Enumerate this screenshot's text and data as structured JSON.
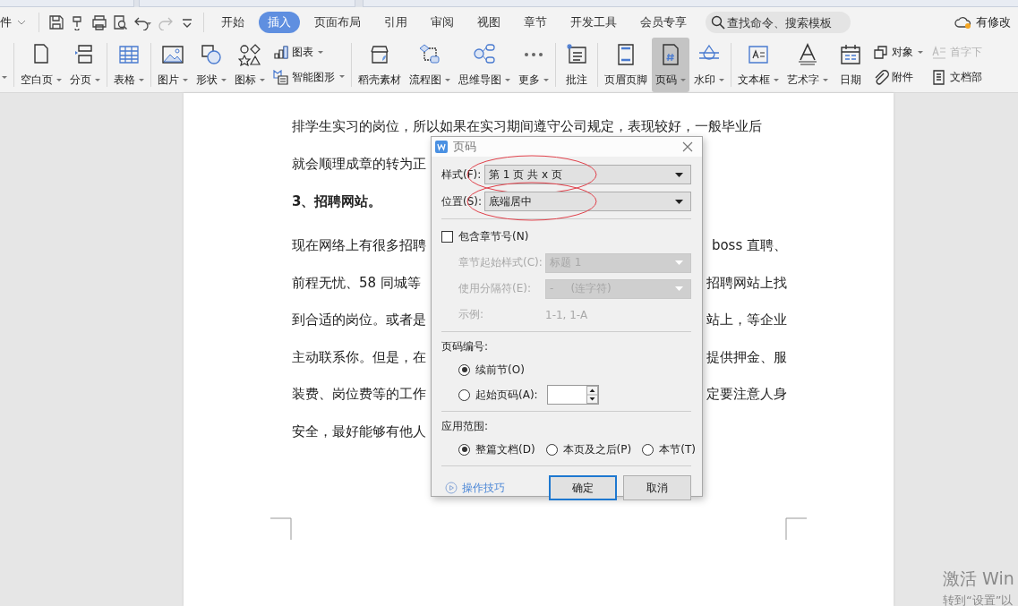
{
  "quick_bar": {
    "file_menu": "件"
  },
  "menu_tabs": [
    {
      "label": "开始",
      "selected": false
    },
    {
      "label": "插入",
      "selected": true
    },
    {
      "label": "页面布局",
      "selected": false
    },
    {
      "label": "引用",
      "selected": false
    },
    {
      "label": "审阅",
      "selected": false
    },
    {
      "label": "视图",
      "selected": false
    },
    {
      "label": "章节",
      "selected": false
    },
    {
      "label": "开发工具",
      "selected": false
    },
    {
      "label": "会员专享",
      "selected": false
    }
  ],
  "search": {
    "placeholder": "查找命令、搜索模板"
  },
  "save_status": {
    "label": "有修改"
  },
  "ribbon": {
    "groups": [
      {
        "items": [
          {
            "kind": "large",
            "label": "空白页",
            "dropdown": true,
            "selected": false,
            "disabled": false
          },
          {
            "kind": "large",
            "label": "分页",
            "dropdown": true,
            "selected": false,
            "disabled": false
          }
        ]
      },
      {
        "items": [
          {
            "kind": "large",
            "label": "表格",
            "dropdown": true,
            "selected": false,
            "disabled": false
          }
        ]
      },
      {
        "items": [
          {
            "kind": "large",
            "label": "图片",
            "dropdown": true,
            "selected": false,
            "disabled": false
          },
          {
            "kind": "large",
            "label": "形状",
            "dropdown": true,
            "selected": false,
            "disabled": false
          },
          {
            "kind": "large",
            "label": "图标",
            "dropdown": true,
            "selected": false,
            "disabled": false
          },
          {
            "kind": "stack",
            "items": [
              {
                "label": "图表",
                "dropdown": true,
                "disabled": false
              },
              {
                "label": "智能图形",
                "dropdown": true,
                "disabled": false
              }
            ]
          }
        ]
      },
      {
        "items": [
          {
            "kind": "large",
            "label": "稻壳素材",
            "dropdown": false,
            "selected": false,
            "disabled": false
          },
          {
            "kind": "large",
            "label": "流程图",
            "dropdown": true,
            "selected": false,
            "disabled": false
          },
          {
            "kind": "large",
            "label": "思维导图",
            "dropdown": true,
            "selected": false,
            "disabled": false
          },
          {
            "kind": "large",
            "label": "更多",
            "dropdown": true,
            "selected": false,
            "disabled": false
          }
        ]
      },
      {
        "items": [
          {
            "kind": "large",
            "label": "批注",
            "dropdown": false,
            "selected": false,
            "disabled": false
          }
        ]
      },
      {
        "items": [
          {
            "kind": "large",
            "label": "页眉页脚",
            "dropdown": false,
            "selected": false,
            "disabled": false
          },
          {
            "kind": "large",
            "label": "页码",
            "dropdown": true,
            "selected": true,
            "disabled": false
          },
          {
            "kind": "large",
            "label": "水印",
            "dropdown": true,
            "selected": false,
            "disabled": false
          }
        ]
      },
      {
        "items": [
          {
            "kind": "large",
            "label": "文本框",
            "dropdown": true,
            "selected": false,
            "disabled": false
          },
          {
            "kind": "large",
            "label": "艺术字",
            "dropdown": true,
            "selected": false,
            "disabled": false
          },
          {
            "kind": "large",
            "label": "日期",
            "dropdown": false,
            "selected": false,
            "disabled": false
          },
          {
            "kind": "stack",
            "items": [
              {
                "label": "对象",
                "dropdown": true,
                "disabled": false
              },
              {
                "label": "附件",
                "dropdown": false,
                "disabled": false
              }
            ]
          },
          {
            "kind": "stack",
            "items": [
              {
                "label": "首字下",
                "dropdown": false,
                "disabled": true
              },
              {
                "label": "文档部",
                "dropdown": false,
                "disabled": false
              }
            ]
          }
        ]
      }
    ]
  },
  "document": {
    "blocks": [
      {
        "kind": "text",
        "lines": [
          {
            "left": "排学生实习的岗位，所以如果在实习期间遵守公司规定，表现较好，一般毕业后"
          },
          {
            "left": "就会顺理成章的转为正"
          }
        ]
      },
      {
        "kind": "heading",
        "text": "3、招聘网站。"
      },
      {
        "kind": "text",
        "lines": [
          {
            "left": "现在网络上有很多招聘",
            "right": "boss 直聘、"
          },
          {
            "left": "前程无忧、58 同城等",
            "right": "招聘网站上找"
          },
          {
            "left": "到合适的岗位。或者是",
            "right": "站上，等企业"
          },
          {
            "left": "主动联系你。但是，在",
            "right": "提供押金、服"
          },
          {
            "left": "装费、岗位费等的工作",
            "right": "定要注意人身"
          },
          {
            "left": "安全，最好能够有他人"
          }
        ]
      }
    ]
  },
  "dialog": {
    "title": "页码",
    "fields": [
      {
        "label": "样式(F):",
        "value": "第 1 页 共 x 页",
        "highlighted": true
      },
      {
        "label": "位置(S):",
        "value": "底端居中",
        "highlighted": true
      }
    ],
    "include_chapter": {
      "label": "包含章节号(N)",
      "checked": false
    },
    "chapter_fields": [
      {
        "label": "章节起始样式(C):",
        "value": "标题 1",
        "disabled": true
      },
      {
        "label": "使用分隔符(E):",
        "value": "-     (连字符)",
        "disabled": true
      }
    ],
    "example": {
      "label": "示例:",
      "value": "1-1, 1-A",
      "disabled": true
    },
    "numbering": {
      "title": "页码编号:",
      "options": [
        {
          "label": "续前节(O)",
          "selected": true
        },
        {
          "label": "起始页码(A):",
          "selected": false
        }
      ]
    },
    "scope": {
      "title": "应用范围:",
      "options": [
        {
          "label": "整篇文档(D)",
          "selected": true
        },
        {
          "label": "本页及之后(P)",
          "selected": false
        },
        {
          "label": "本节(T)",
          "selected": false
        }
      ]
    },
    "tips_link": "操作技巧",
    "buttons": [
      {
        "label": "确定",
        "default": true
      },
      {
        "label": "取消",
        "default": false
      }
    ]
  },
  "os_notice": {
    "lines": [
      "激活 Win",
      "转到“设置”以"
    ]
  }
}
